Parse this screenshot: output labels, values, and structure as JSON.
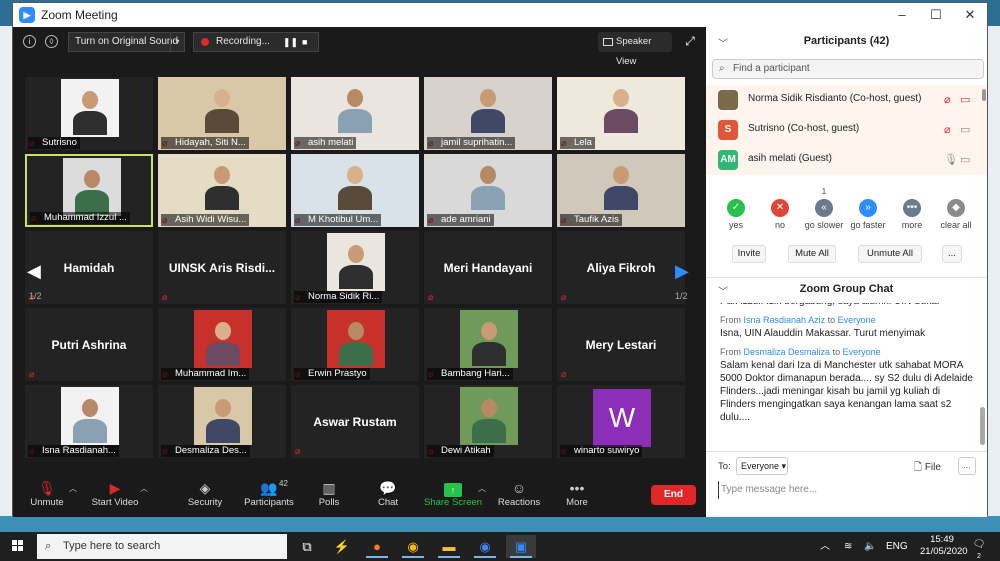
{
  "window": {
    "title": "Zoom Meeting",
    "controls": [
      "–",
      "☐",
      "✕"
    ]
  },
  "topbar": {
    "original_sound": "Turn on Original Sound",
    "recording": "Recording...",
    "speaker_view": "Speaker View"
  },
  "tiles": [
    {
      "name": "Sutrisno",
      "kind": "video"
    },
    {
      "name": "Hidayah, Siti N...",
      "kind": "video"
    },
    {
      "name": "asih melati",
      "kind": "video"
    },
    {
      "name": "jamil suprihatin...",
      "kind": "video"
    },
    {
      "name": "Lela",
      "kind": "video"
    },
    {
      "name": "Muhammad Izzul ...",
      "kind": "video",
      "active": true
    },
    {
      "name": "Asih Widi Wisu...",
      "kind": "video"
    },
    {
      "name": "M Khotibul Um...",
      "kind": "video"
    },
    {
      "name": "ade amriani",
      "kind": "video"
    },
    {
      "name": "Taufik Azis",
      "kind": "video"
    },
    {
      "name": "Hamidah",
      "kind": "name"
    },
    {
      "name": "UINSK Aris Risdi...",
      "kind": "name"
    },
    {
      "name": "Norma Sidik Ri...",
      "kind": "video"
    },
    {
      "name": "Meri Handayani",
      "kind": "name"
    },
    {
      "name": "Aliya Fikroh",
      "kind": "name"
    },
    {
      "name": "Putri Ashrina",
      "kind": "name"
    },
    {
      "name": "Muhammad Im...",
      "kind": "video"
    },
    {
      "name": "Erwin Prastyo",
      "kind": "video"
    },
    {
      "name": "Bambang Hari...",
      "kind": "video"
    },
    {
      "name": "Mery Lestari",
      "kind": "name"
    },
    {
      "name": "Isna Rasdianah...",
      "kind": "video"
    },
    {
      "name": "Desmaliza Des...",
      "kind": "video"
    },
    {
      "name": "Aswar Rustam",
      "kind": "name"
    },
    {
      "name": "Dewi Atikah",
      "kind": "video"
    },
    {
      "name": "winarto suwiryo",
      "kind": "letter",
      "letter": "W"
    }
  ],
  "pager": {
    "left": "1/2",
    "right": "1/2"
  },
  "toolbar": {
    "unmute": "Unmute",
    "start_video": "Start Video",
    "security": "Security",
    "participants": "Participants",
    "participants_count": "42",
    "polls": "Polls",
    "chat": "Chat",
    "share_screen": "Share Screen",
    "reactions": "Reactions",
    "more": "More",
    "end": "End"
  },
  "panel": {
    "participants_title": "Participants (42)",
    "search_placeholder": "Find a participant",
    "participants": [
      {
        "name": "Norma Sidik Risdianto (Co-host, guest)",
        "avatar": "",
        "color": "#7a6a4a"
      },
      {
        "name": "Sutrisno (Co-host, guest)",
        "avatar": "S",
        "color": "#e0583a"
      },
      {
        "name": "asih melati (Guest)",
        "avatar": "AM",
        "color": "#2eb872"
      }
    ],
    "reactions": [
      {
        "label": "yes",
        "glyph": "✓",
        "color": "#27c24c",
        "count": ""
      },
      {
        "label": "no",
        "glyph": "✕",
        "color": "#e0453a",
        "count": ""
      },
      {
        "label": "go slower",
        "glyph": "«",
        "color": "#6b7a8f",
        "count": "1"
      },
      {
        "label": "go faster",
        "glyph": "»",
        "color": "#2d8cff",
        "count": ""
      },
      {
        "label": "more",
        "glyph": "•••",
        "color": "#6b7a8f",
        "count": ""
      },
      {
        "label": "clear all",
        "glyph": "◆",
        "color": "#8a8a8a",
        "count": ""
      }
    ],
    "buttons": {
      "invite": "Invite",
      "mute_all": "Mute All",
      "unmute_all": "Unmute All",
      "more": "..."
    },
    "chat_title": "Zoom Group Chat",
    "messages": [
      {
        "from": "",
        "to": "",
        "text": "Pak Izzul. Izin bergabung, saya alumni UIN Suka."
      },
      {
        "from": "Isna Rasdianah Aziz",
        "to": "Everyone",
        "text": "Isna, UIN Alauddin Makassar. Turut menyimak"
      },
      {
        "from": "Desmaliza Desmaliza",
        "to": "Everyone",
        "text": "Salam kenal dari Iza di Manchester utk sahabat MORA 5000 Doktor dimanapun berada.... sy S2 dulu di Adelaide Flinders...jadi meningar kisah bu jamil yg kuliah di Flinders mengingatkan saya kenangan lama saat s2 dulu...."
      }
    ],
    "from_label": "From",
    "to_word": "to",
    "to_label": "To:",
    "to_value": "Everyone",
    "file": "File",
    "more": "...",
    "input_placeholder": "Type message here..."
  },
  "taskbar": {
    "search": "Type here to search",
    "lang": "ENG",
    "time": "15:49",
    "date": "21/05/2020",
    "notif": "2"
  }
}
